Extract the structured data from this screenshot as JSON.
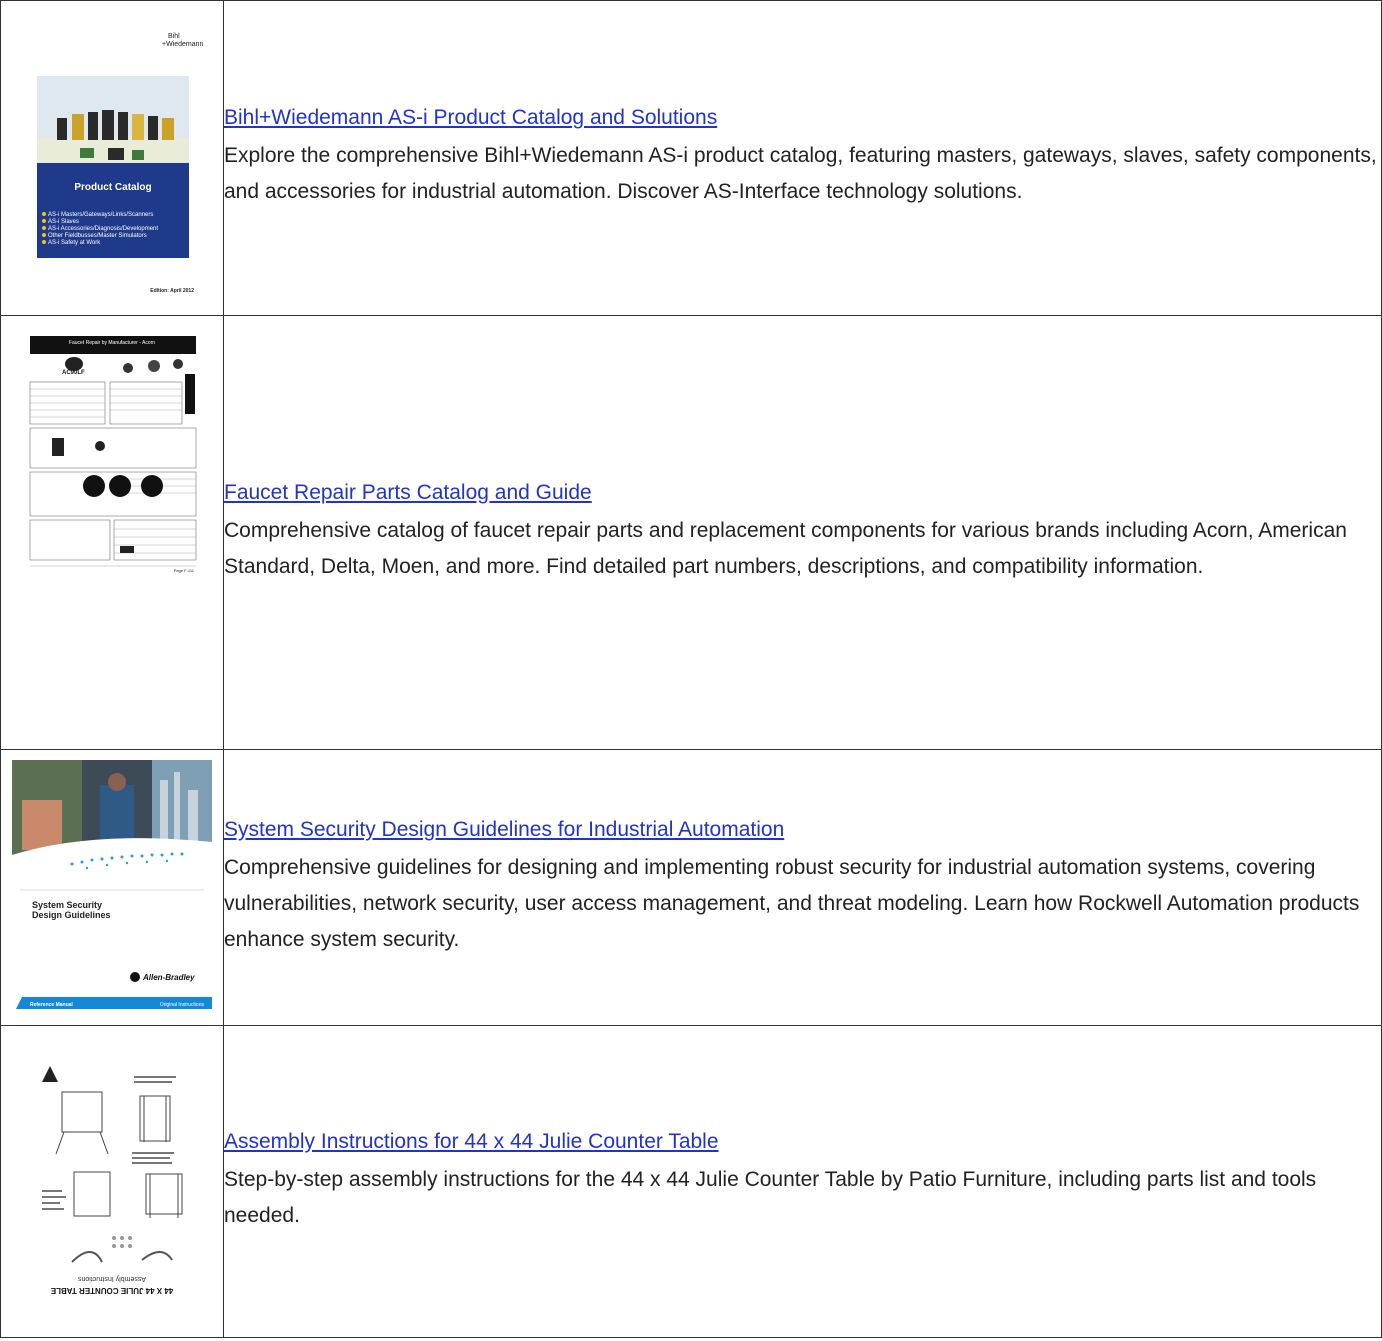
{
  "results": [
    {
      "title": "Bihl+Wiedemann AS-i Product Catalog and Solutions",
      "description": "Explore the comprehensive Bihl+Wiedemann AS-i product catalog, featuring masters, gateways, slaves, safety components, and accessories for industrial automation. Discover AS-Interface technology solutions.",
      "thumb": {
        "logo_line1": "Bihl",
        "logo_line2": "+Wiedemann",
        "heading": "Product Catalog",
        "bullets": [
          "AS-i Masters/Gateways/Links/Scanners",
          "AS-i Slaves",
          "AS-i Accessories/Diagnosis/Development",
          "Other Fieldbusses/Master Simulators",
          "AS-i Safety at Work"
        ],
        "edition": "Edition: April 2012"
      }
    },
    {
      "title": "Faucet Repair Parts Catalog and Guide",
      "description": "Comprehensive catalog of faucet repair parts and replacement components for various brands including Acorn, American Standard, Delta, Moen, and more. Find detailed part numbers, descriptions, and compatibility information.",
      "thumb": {
        "header": "Faucet Repair by Manufacturer - Acorn",
        "model": "AC90LF",
        "page": "Page F-111"
      }
    },
    {
      "title": "System Security Design Guidelines for Industrial Automation",
      "description": "Comprehensive guidelines for designing and implementing robust security for industrial automation systems, covering vulnerabilities, network security, user access management, and threat modeling. Learn how Rockwell Automation products enhance system security.",
      "thumb": {
        "heading_line1": "System Security",
        "heading_line2": "Design Guidelines",
        "brand": "Allen-Bradley",
        "footer_left": "Reference Manual",
        "footer_right": "Original Instructions"
      }
    },
    {
      "title": "Assembly Instructions for 44 x 44 Julie Counter Table",
      "description": "Step-by-step assembly instructions for the 44 x 44 Julie Counter Table by Patio Furniture, including parts list and tools needed.",
      "thumb": {
        "heading": "44 X 44 JULIE COUNTER TABLE",
        "subheading": "Assembly Instructions"
      }
    }
  ]
}
